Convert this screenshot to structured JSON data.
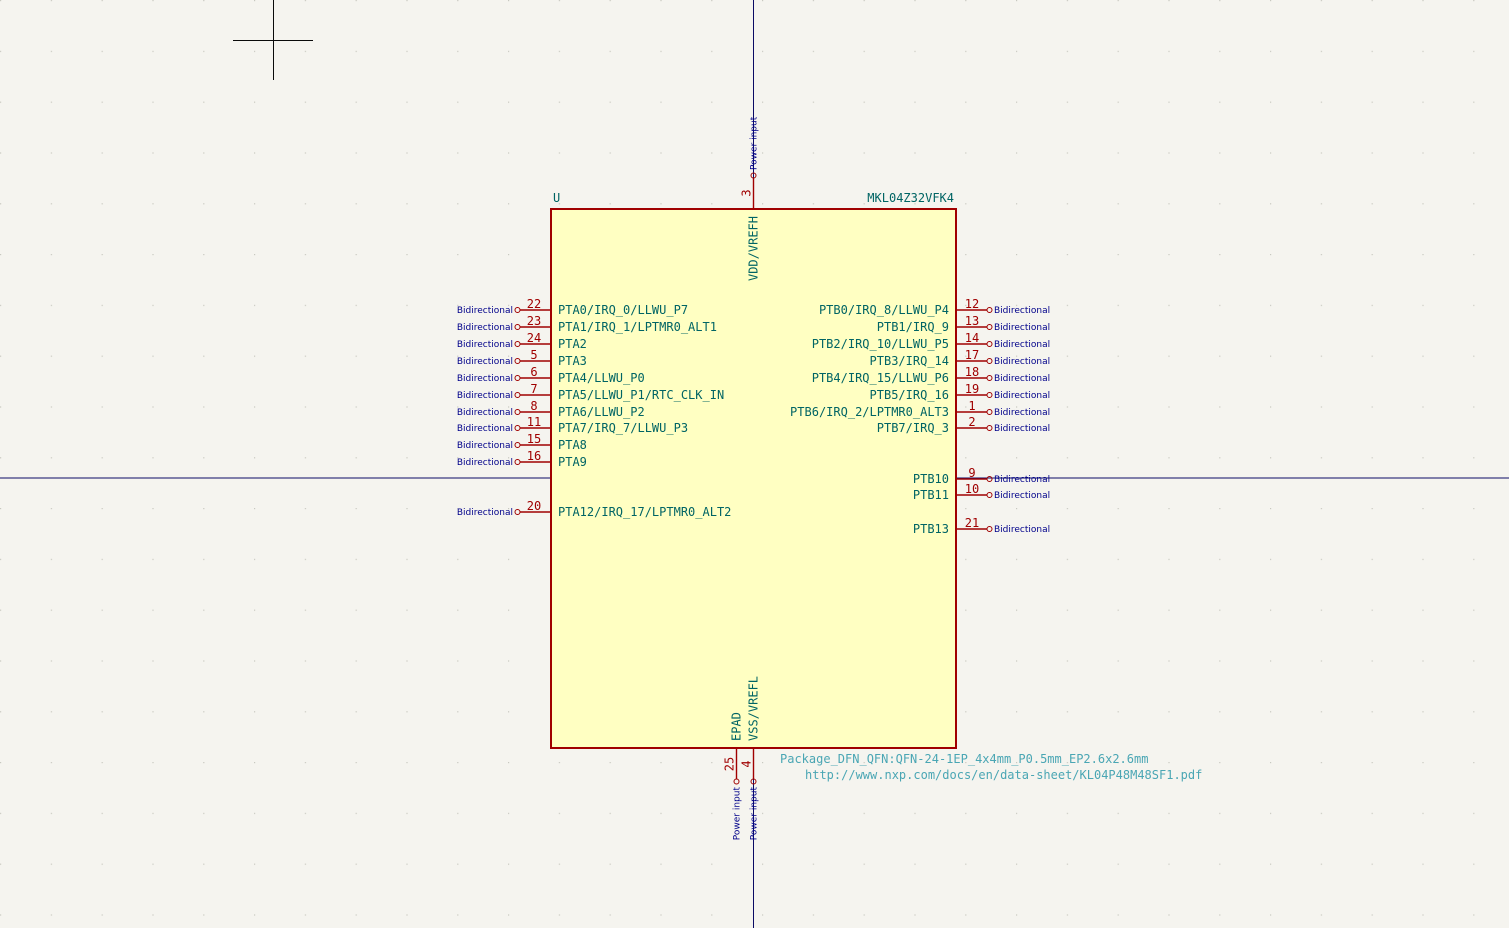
{
  "colors": {
    "background": "#f5f4ef",
    "grid_dot": "#c8c8c0",
    "axis": "#0a0a64",
    "body_fill": "#ffffc2",
    "body_stroke": "#a00000",
    "pin_line": "#a00000",
    "pin_number": "#a00000",
    "pin_name": "#006464",
    "electrical_type": "#00008a",
    "field": "#4aa6b4"
  },
  "symbol": {
    "reference": "U",
    "value": "MKL04Z32VFK4",
    "footprint": "Package_DFN_QFN:QFN-24-1EP_4x4mm_P0.5mm_EP2.6x2.6mm",
    "datasheet": "http://www.nxp.com/docs/en/data-sheet/KL04P48M48SF1.pdf"
  },
  "left_pins": [
    {
      "number": "22",
      "name": "PTA0/IRQ_0/LLWU_P7",
      "type": "Bidirectional"
    },
    {
      "number": "23",
      "name": "PTA1/IRQ_1/LPTMR0_ALT1",
      "type": "Bidirectional"
    },
    {
      "number": "24",
      "name": "PTA2",
      "type": "Bidirectional"
    },
    {
      "number": "5",
      "name": "PTA3",
      "type": "Bidirectional"
    },
    {
      "number": "6",
      "name": "PTA4/LLWU_P0",
      "type": "Bidirectional"
    },
    {
      "number": "7",
      "name": "PTA5/LLWU_P1/RTC_CLK_IN",
      "type": "Bidirectional"
    },
    {
      "number": "8",
      "name": "PTA6/LLWU_P2",
      "type": "Bidirectional"
    },
    {
      "number": "11",
      "name": "PTA7/IRQ_7/LLWU_P3",
      "type": "Bidirectional"
    },
    {
      "number": "15",
      "name": "PTA8",
      "type": "Bidirectional"
    },
    {
      "number": "16",
      "name": "PTA9",
      "type": "Bidirectional"
    },
    {
      "number": "20",
      "name": "PTA12/IRQ_17/LPTMR0_ALT2",
      "type": "Bidirectional"
    }
  ],
  "right_pins": [
    {
      "number": "12",
      "name": "PTB0/IRQ_8/LLWU_P4",
      "type": "Bidirectional"
    },
    {
      "number": "13",
      "name": "PTB1/IRQ_9",
      "type": "Bidirectional"
    },
    {
      "number": "14",
      "name": "PTB2/IRQ_10/LLWU_P5",
      "type": "Bidirectional"
    },
    {
      "number": "17",
      "name": "PTB3/IRQ_14",
      "type": "Bidirectional"
    },
    {
      "number": "18",
      "name": "PTB4/IRQ_15/LLWU_P6",
      "type": "Bidirectional"
    },
    {
      "number": "19",
      "name": "PTB5/IRQ_16",
      "type": "Bidirectional"
    },
    {
      "number": "1",
      "name": "PTB6/IRQ_2/LPTMR0_ALT3",
      "type": "Bidirectional"
    },
    {
      "number": "2",
      "name": "PTB7/IRQ_3",
      "type": "Bidirectional"
    },
    {
      "number": "9",
      "name": "PTB10",
      "type": "Bidirectional"
    },
    {
      "number": "10",
      "name": "PTB11",
      "type": "Bidirectional"
    },
    {
      "number": "21",
      "name": "PTB13",
      "type": "Bidirectional"
    }
  ],
  "top_pins": [
    {
      "number": "3",
      "name": "VDD/VREFH",
      "type": "Power input"
    }
  ],
  "bottom_pins": [
    {
      "number": "25",
      "name": "EPAD",
      "type": "Power input"
    },
    {
      "number": "4",
      "name": "VSS/VREFL",
      "type": "Power input"
    }
  ]
}
